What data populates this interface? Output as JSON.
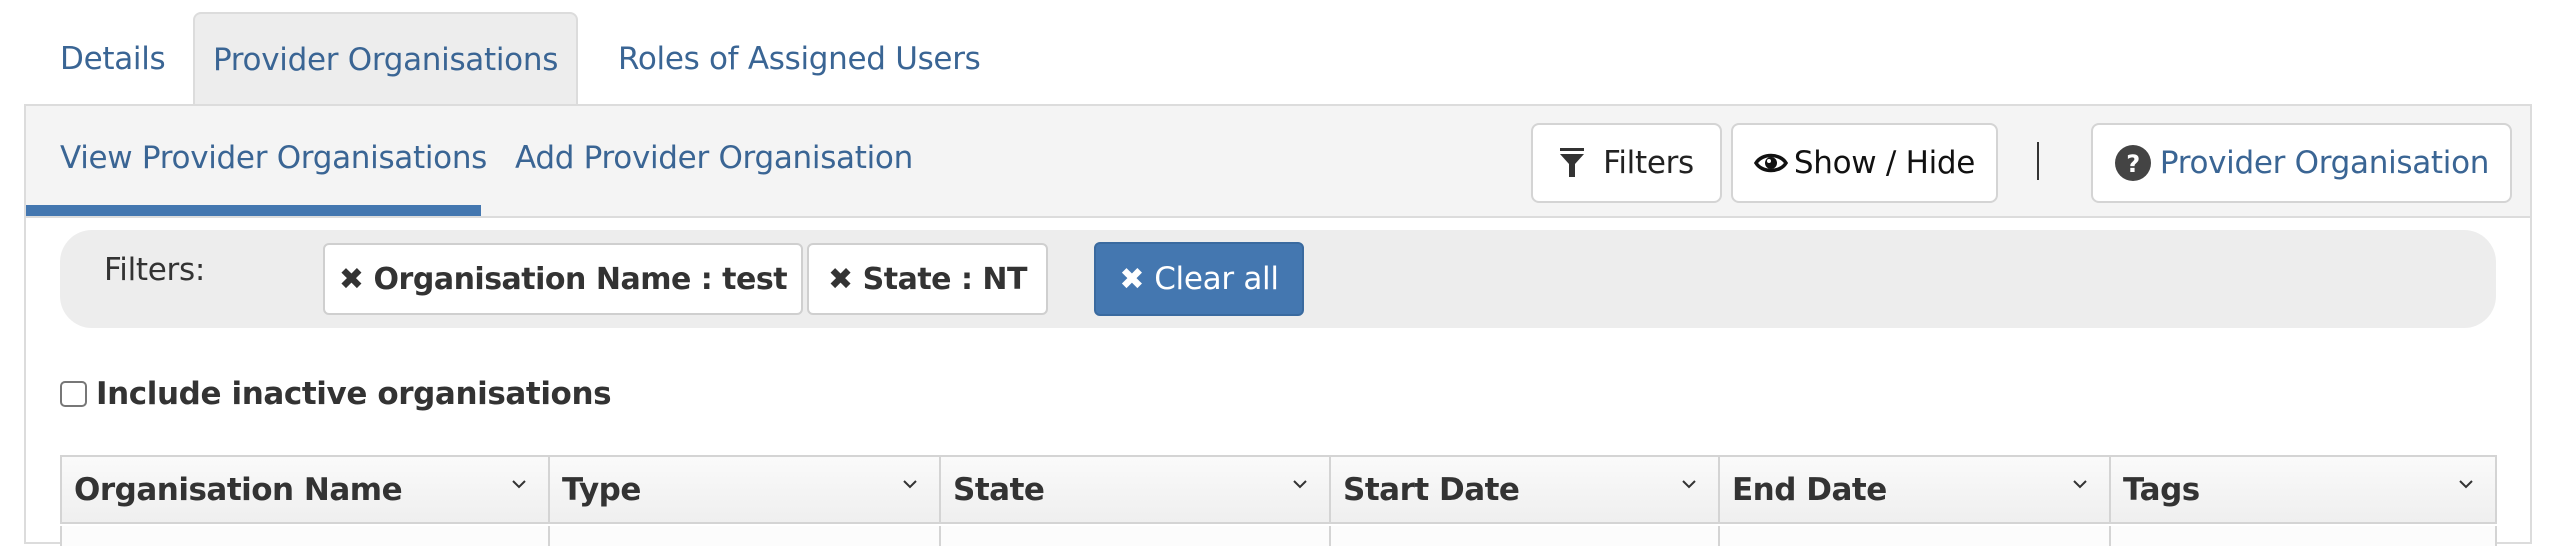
{
  "top_tabs": [
    {
      "label": "Details",
      "active": false
    },
    {
      "label": "Provider Organisations",
      "active": true
    },
    {
      "label": "Roles of Assigned Users",
      "active": false
    }
  ],
  "sub_tabs": [
    {
      "label": "View Provider Organisations",
      "active": true
    },
    {
      "label": "Add Provider Organisation",
      "active": false
    }
  ],
  "toolbar": {
    "filters_label": "Filters",
    "filters_icon": "filter-funnel-icon",
    "show_hide_label": "Show / Hide",
    "show_hide_icon": "eye-icon",
    "help_label": "Provider Organisation",
    "help_icon": "question-circle-icon"
  },
  "filter_bar": {
    "label": "Filters:",
    "chips": [
      {
        "label": "Organisation Name : test",
        "icon": "remove-x-icon"
      },
      {
        "label": "State : NT",
        "icon": "remove-x-icon"
      }
    ],
    "clear_all_label": "Clear all"
  },
  "include_inactive": {
    "label": "Include inactive organisations",
    "checked": false
  },
  "table": {
    "columns": [
      "Organisation Name",
      "Type",
      "State",
      "Start Date",
      "End Date",
      "Tags"
    ]
  },
  "colors": {
    "accent": "#4477b0",
    "link": "#3a6594",
    "panel_header_bg": "#f4f4f4",
    "filter_bar_bg": "#ededed"
  }
}
